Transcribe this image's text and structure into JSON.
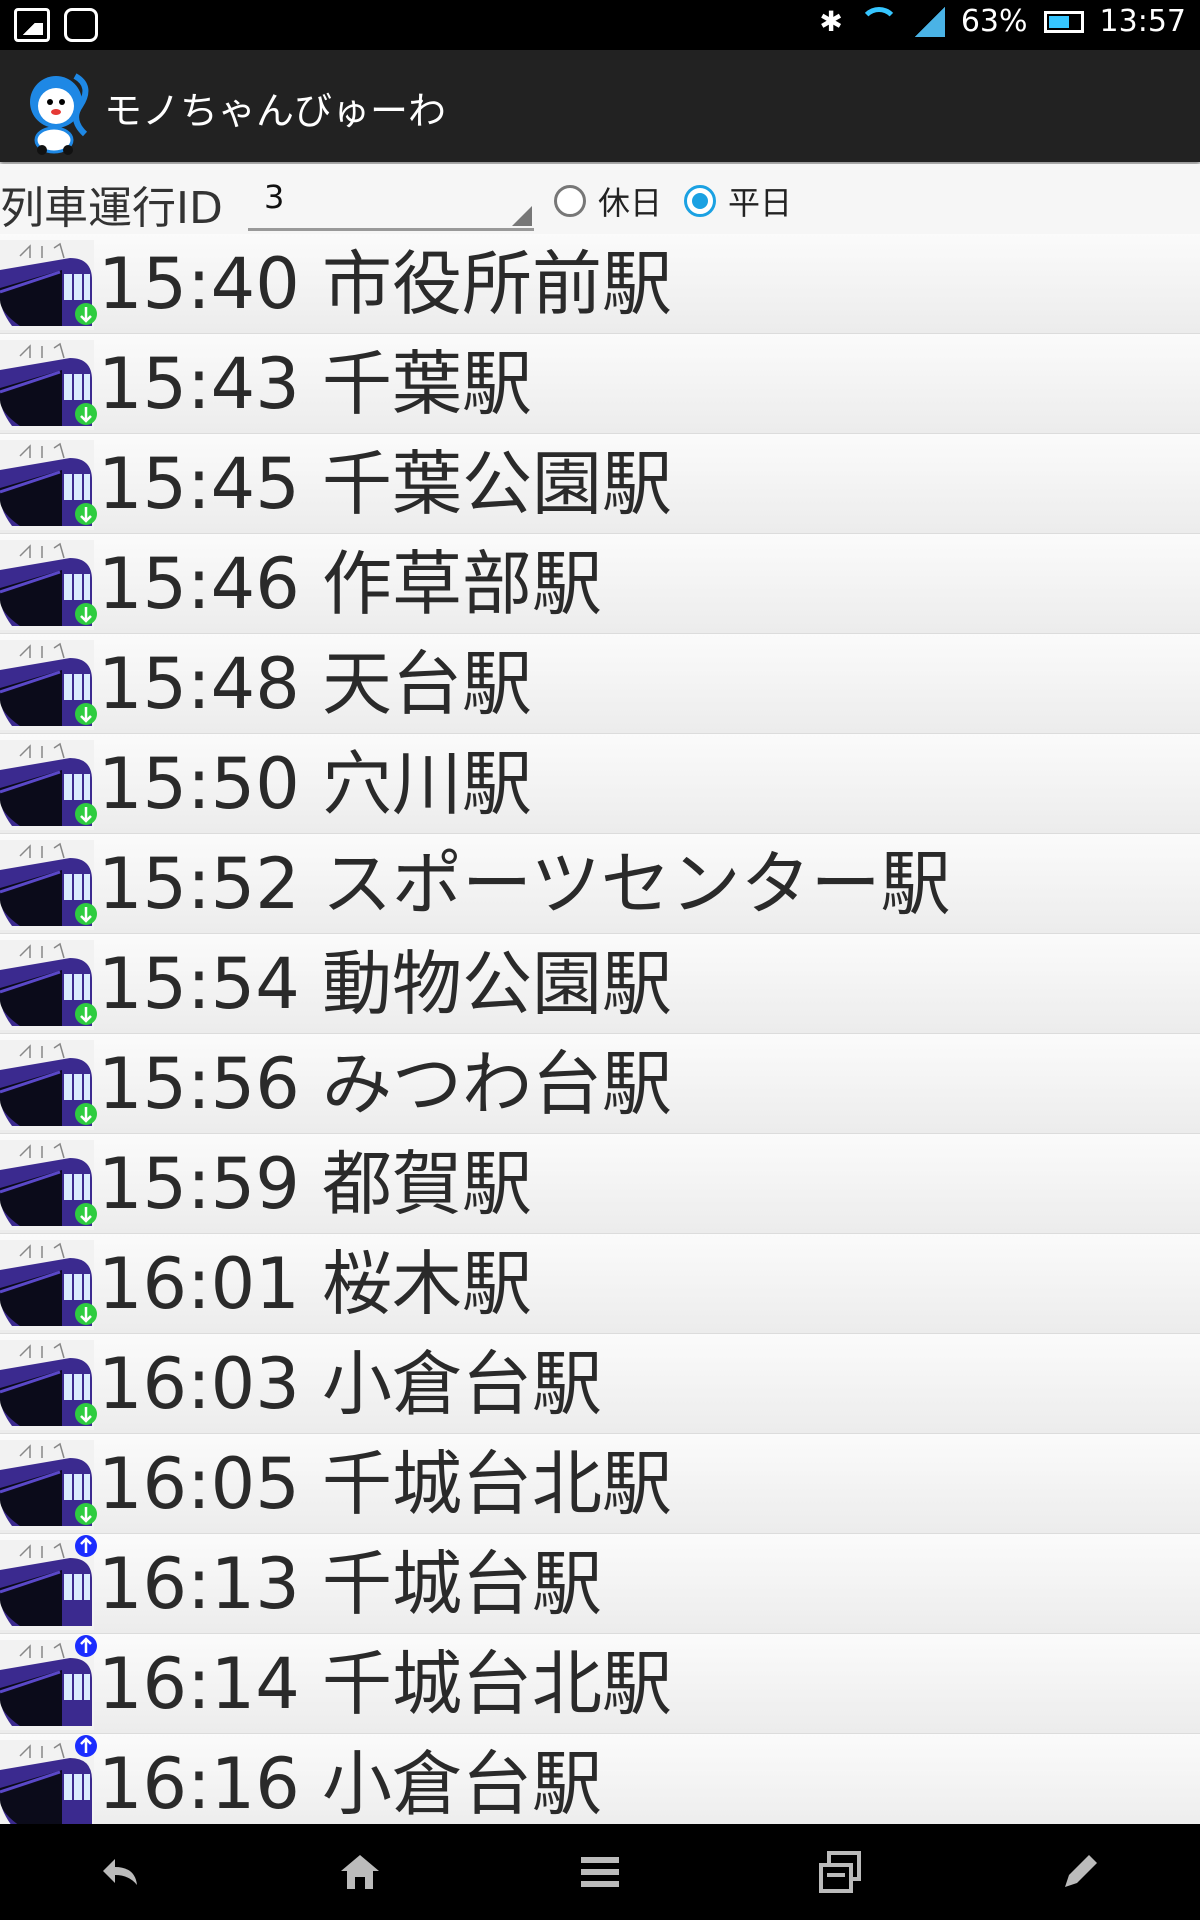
{
  "status_bar": {
    "battery": "63%",
    "time": "13:57",
    "icons": [
      "gallery-icon",
      "smartwatch-icon",
      "bluetooth-icon",
      "wifi-icon",
      "signal-icon",
      "battery-icon"
    ]
  },
  "app": {
    "title": "モノちゃんびゅーわ",
    "logo_icon": "monkey-mascot-icon"
  },
  "controls": {
    "id_label": "列車運行ID",
    "id_value": "3",
    "holiday_label": "休日",
    "weekday_label": "平日",
    "selected": "平日"
  },
  "colors": {
    "accent": "#1ba1e2",
    "down_arrow": "#2ecc40",
    "up_arrow": "#1a2cff"
  },
  "stops": [
    {
      "time": "15:40",
      "station": "市役所前駅",
      "dir": "down"
    },
    {
      "time": "15:43",
      "station": "千葉駅",
      "dir": "down"
    },
    {
      "time": "15:45",
      "station": "千葉公園駅",
      "dir": "down"
    },
    {
      "time": "15:46",
      "station": "作草部駅",
      "dir": "down"
    },
    {
      "time": "15:48",
      "station": "天台駅",
      "dir": "down"
    },
    {
      "time": "15:50",
      "station": "穴川駅",
      "dir": "down"
    },
    {
      "time": "15:52",
      "station": "スポーツセンター駅",
      "dir": "down"
    },
    {
      "time": "15:54",
      "station": "動物公園駅",
      "dir": "down"
    },
    {
      "time": "15:56",
      "station": "みつわ台駅",
      "dir": "down"
    },
    {
      "time": "15:59",
      "station": "都賀駅",
      "dir": "down"
    },
    {
      "time": "16:01",
      "station": "桜木駅",
      "dir": "down"
    },
    {
      "time": "16:03",
      "station": "小倉台駅",
      "dir": "down"
    },
    {
      "time": "16:05",
      "station": "千城台北駅",
      "dir": "down"
    },
    {
      "time": "16:13",
      "station": "千城台駅",
      "dir": "up"
    },
    {
      "time": "16:14",
      "station": "千城台北駅",
      "dir": "up"
    },
    {
      "time": "16:16",
      "station": "小倉台駅",
      "dir": "up"
    }
  ],
  "nav": [
    "back-icon",
    "home-icon",
    "menu-icon",
    "recent-apps-icon",
    "edit-icon"
  ]
}
